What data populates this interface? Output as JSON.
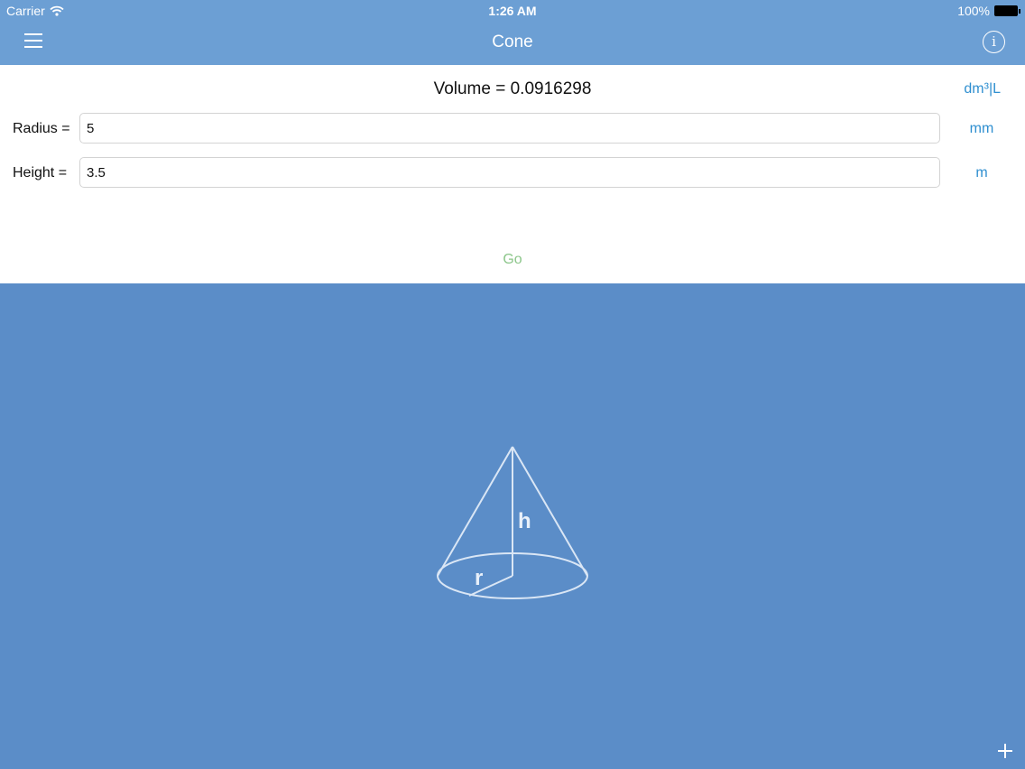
{
  "status": {
    "carrier": "Carrier",
    "time": "1:26 AM",
    "battery": "100%"
  },
  "nav": {
    "title": "Cone"
  },
  "result": {
    "label": "Volume = 0.0916298",
    "unit": "dm³|L"
  },
  "fields": [
    {
      "label": "Radius =",
      "value": "5",
      "unit": "mm"
    },
    {
      "label": "Height =",
      "value": "3.5",
      "unit": "m"
    }
  ],
  "go_label": "Go",
  "diagram": {
    "height_label": "h",
    "radius_label": "r"
  }
}
